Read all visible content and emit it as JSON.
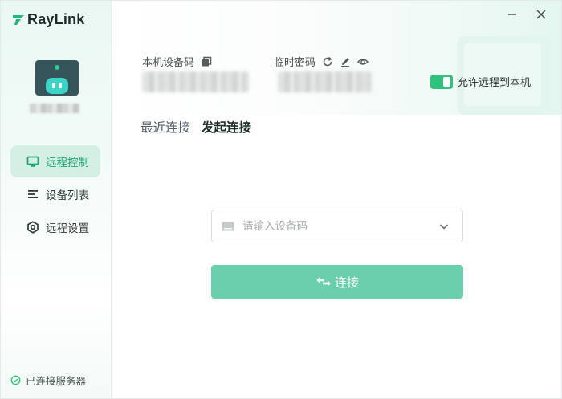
{
  "app": {
    "name": "RayLink"
  },
  "sidebar": {
    "items": [
      {
        "label": "远程控制",
        "active": true
      },
      {
        "label": "设备列表",
        "active": false
      },
      {
        "label": "远程设置",
        "active": false
      }
    ],
    "status": "已连接服务器"
  },
  "header": {
    "device_code_label": "本机设备码",
    "temp_password_label": "临时密码",
    "allow_remote_label": "允许远程到本机",
    "allow_remote_enabled": true
  },
  "tabs": [
    {
      "label": "最近连接",
      "active": false
    },
    {
      "label": "发起连接",
      "active": true
    }
  ],
  "connect": {
    "placeholder": "请输入设备码",
    "button_label": "连接"
  },
  "colors": {
    "accent": "#2ec27e",
    "button": "#69cfac",
    "nav_active_bg": "#d4efe4"
  }
}
